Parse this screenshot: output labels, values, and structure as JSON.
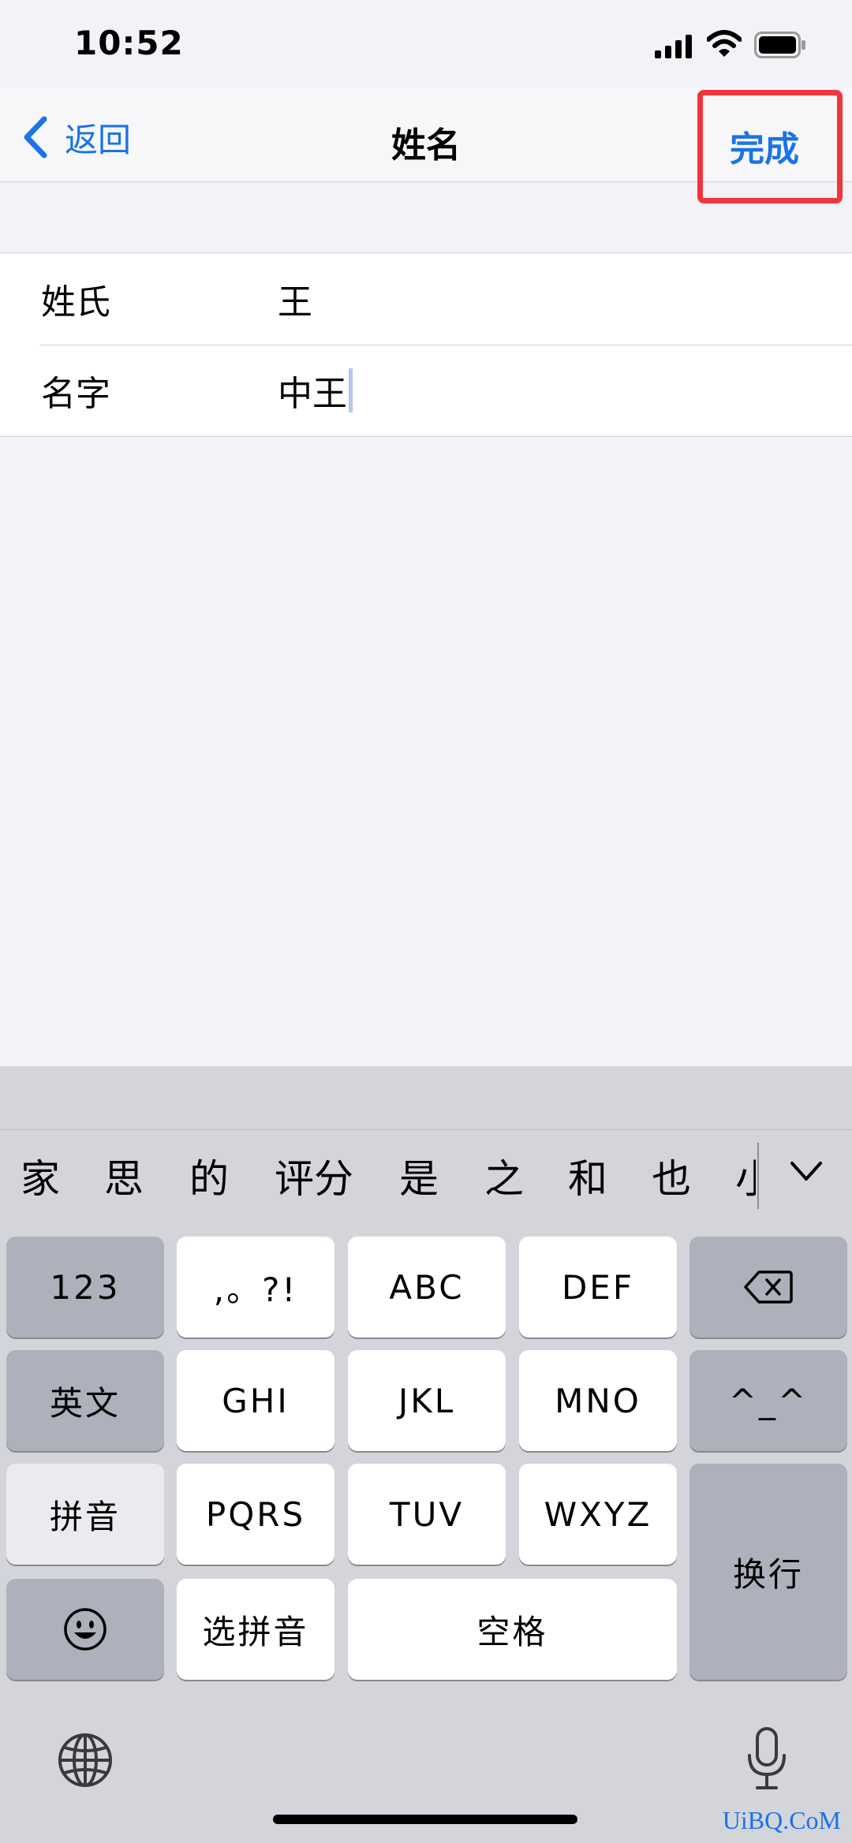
{
  "status_bar": {
    "time": "10:52"
  },
  "nav": {
    "back_label": "返回",
    "title": "姓名",
    "done_label": "完成"
  },
  "form": {
    "rows": [
      {
        "label": "姓氏",
        "value": "王"
      },
      {
        "label": "名字",
        "value": "中王"
      }
    ]
  },
  "keyboard": {
    "candidates": [
      "家",
      "思",
      "的",
      "评分",
      "是",
      "之",
      "和",
      "也",
      "小"
    ],
    "keys": {
      "num": "123",
      "punct": ",。?!",
      "abc": "ABC",
      "def": "DEF",
      "english": "英文",
      "ghi": "GHI",
      "jkl": "JKL",
      "mno": "MNO",
      "face": "^_^",
      "pinyin": "拼音",
      "pqrs": "PQRS",
      "tuv": "TUV",
      "wxyz": "WXYZ",
      "select_pinyin": "选拼音",
      "space": "空格",
      "return": "换行"
    }
  },
  "watermark": "UiBQ.CoM",
  "colors": {
    "accent": "#1a73e8",
    "highlight_box": "#f0353d"
  }
}
